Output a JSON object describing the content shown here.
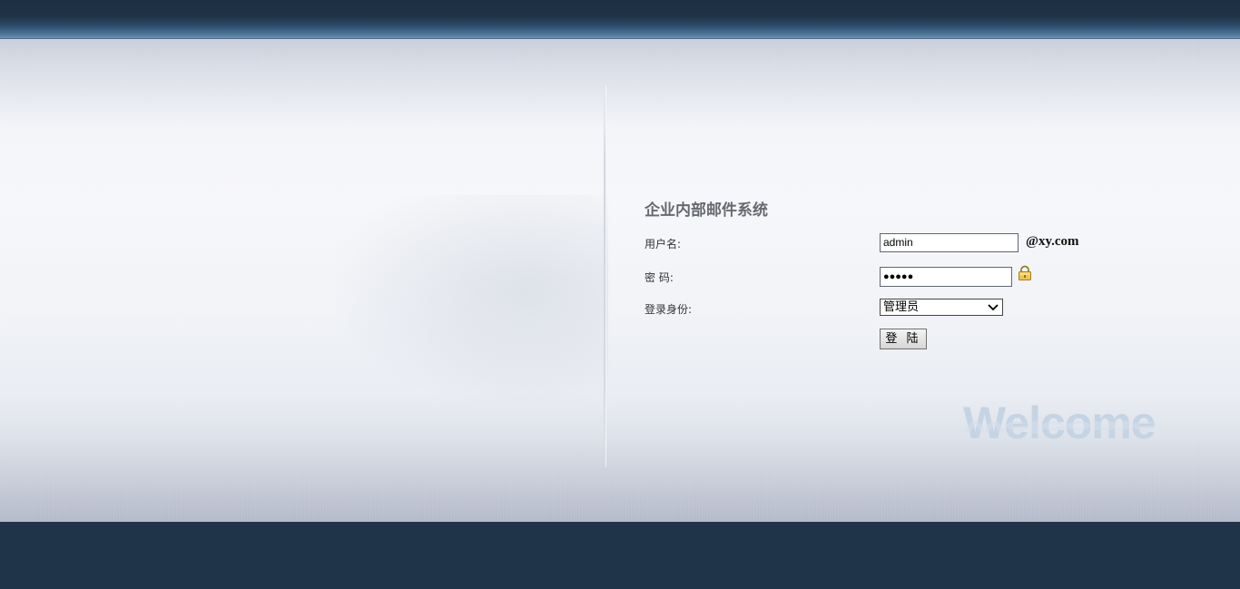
{
  "app": {
    "title": "企业内部邮件系统"
  },
  "form": {
    "username_label": "用户名:",
    "username_value": "admin",
    "domain_suffix": "@xy.com",
    "password_label": "密 码:",
    "password_value": "●●●●●",
    "role_label": "登录身份:",
    "role_selected": "管理员",
    "login_button_label": "登 陆"
  },
  "decor": {
    "welcome_text": "Welcome"
  },
  "icons": {
    "password_hint": "lock-icon",
    "select_arrow": "chevron-down-icon"
  },
  "colors": {
    "header_bar": "#1f3449",
    "footer_bar": "#1f3449",
    "title_text": "#666a70",
    "welcome_text": "#c5d4e4"
  }
}
